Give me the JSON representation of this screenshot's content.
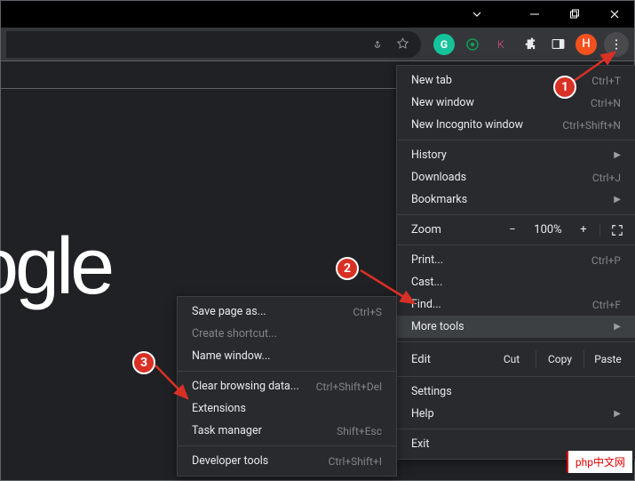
{
  "titlebar": {
    "minimize": "Minimize",
    "maximize": "Maximize",
    "close": "Close"
  },
  "toolbar": {
    "share_icon": "share",
    "star_icon": "star",
    "ext_grammarly": "G",
    "ext_green": "●",
    "ext_k": "K",
    "ext_puzzle": "puzzle",
    "ext_panel": "panel",
    "profile_letter": "H"
  },
  "content": {
    "logo_fragment": "ogle"
  },
  "main_menu": {
    "new_tab": {
      "label": "New tab",
      "shortcut": "Ctrl+T"
    },
    "new_window": {
      "label": "New window",
      "shortcut": "Ctrl+N"
    },
    "incognito": {
      "label": "New Incognito window",
      "shortcut": "Ctrl+Shift+N"
    },
    "history": {
      "label": "History"
    },
    "downloads": {
      "label": "Downloads",
      "shortcut": "Ctrl+J"
    },
    "bookmarks": {
      "label": "Bookmarks"
    },
    "zoom": {
      "label": "Zoom",
      "minus": "−",
      "value": "100%",
      "plus": "+"
    },
    "print": {
      "label": "Print...",
      "shortcut": "Ctrl+P"
    },
    "cast": {
      "label": "Cast..."
    },
    "find": {
      "label": "Find...",
      "shortcut": "Ctrl+F"
    },
    "more_tools": {
      "label": "More tools"
    },
    "edit": {
      "label": "Edit",
      "cut": "Cut",
      "copy": "Copy",
      "paste": "Paste"
    },
    "settings": {
      "label": "Settings"
    },
    "help": {
      "label": "Help"
    },
    "exit": {
      "label": "Exit"
    }
  },
  "submenu": {
    "save_page": {
      "label": "Save page as...",
      "shortcut": "Ctrl+S"
    },
    "create_shortcut": {
      "label": "Create shortcut..."
    },
    "name_window": {
      "label": "Name window..."
    },
    "clear_browsing": {
      "label": "Clear browsing data...",
      "shortcut": "Ctrl+Shift+Del"
    },
    "extensions": {
      "label": "Extensions"
    },
    "task_manager": {
      "label": "Task manager",
      "shortcut": "Shift+Esc"
    },
    "developer_tools": {
      "label": "Developer tools",
      "shortcut": "Ctrl+Shift+I"
    }
  },
  "annotations": {
    "badge1": "1",
    "badge2": "2",
    "badge3": "3"
  },
  "watermark": "php中文网"
}
